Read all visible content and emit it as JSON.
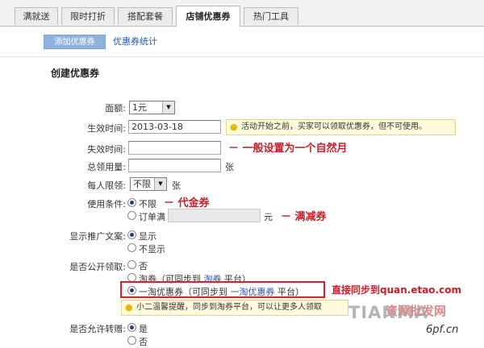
{
  "tabs": [
    "满就送",
    "限时打折",
    "搭配套餐",
    "店铺优惠券",
    "热门工具"
  ],
  "sub": {
    "add_button": "添加优惠券",
    "stats_link": "优惠券统计"
  },
  "section_title": "创建优惠券",
  "form": {
    "amount": {
      "label": "面额:",
      "value": "1元"
    },
    "start": {
      "label": "生效时间:",
      "value": "2013-03-18",
      "tip": "活动开始之前，买家可以领取优惠券，但不可使用。"
    },
    "end": {
      "label": "失效时间:",
      "value": "",
      "annotation": "－ 一般设置为一个自然月"
    },
    "total": {
      "label": "总领用量:",
      "value": "",
      "unit": "张"
    },
    "per_person": {
      "label": "每人限领:",
      "value": "不限",
      "unit": "张"
    },
    "condition": {
      "label": "使用条件:",
      "opt_none": "不限",
      "anno_none": "－ 代金券",
      "opt_min": "订单满",
      "min_value": "",
      "min_unit": "元",
      "anno_min": "－ 满减券"
    },
    "promo_text": {
      "label": "显示推广文案:",
      "opt_show": "显示",
      "opt_hide": "不显示"
    },
    "public_claim": {
      "label": "是否公开领取:",
      "opt_no": "否",
      "opt_taoquan_pre": "淘券（可同步到 ",
      "opt_taoquan_link": "淘券",
      "opt_taoquan_post": " 平台）",
      "opt_yitao_pre": "一淘优惠券（可同步到 ",
      "opt_yitao_link": "一淘优惠券",
      "opt_yitao_post": " 平台）",
      "yitao_annotation": "直接同步到quan.etao.com",
      "yitao_tip": "小二温馨提醒，同步到淘券平台，可以让更多人领取"
    },
    "transfer": {
      "label": "是否允许转赠:",
      "opt_yes": "是",
      "opt_no": "否"
    }
  },
  "watermark": {
    "left": "TIANMA",
    "mid": "资源批发网",
    "right": "6pf.cn"
  }
}
